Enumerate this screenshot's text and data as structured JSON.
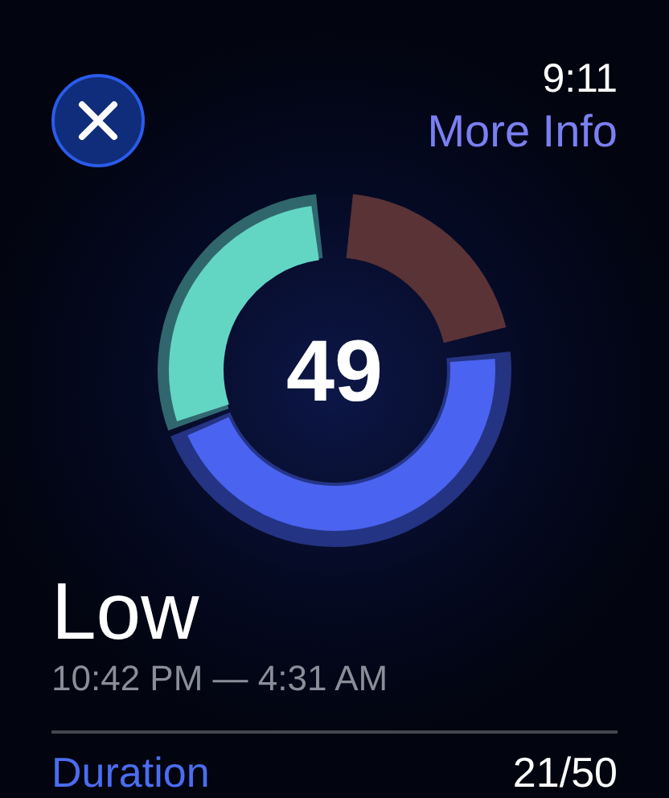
{
  "header": {
    "time": "9:11",
    "link": "More Info"
  },
  "ring": {
    "score": "49",
    "segments": [
      {
        "color": "#63d6c3",
        "filled": true
      },
      {
        "color": "#5a3336",
        "filled": false
      },
      {
        "color": "#4a63f0",
        "filled": true
      }
    ]
  },
  "summary": {
    "rating": "Low",
    "range": "10:42 PM — 4:31 AM"
  },
  "metrics": [
    {
      "label": "Duration",
      "value": "21/50"
    }
  ]
}
